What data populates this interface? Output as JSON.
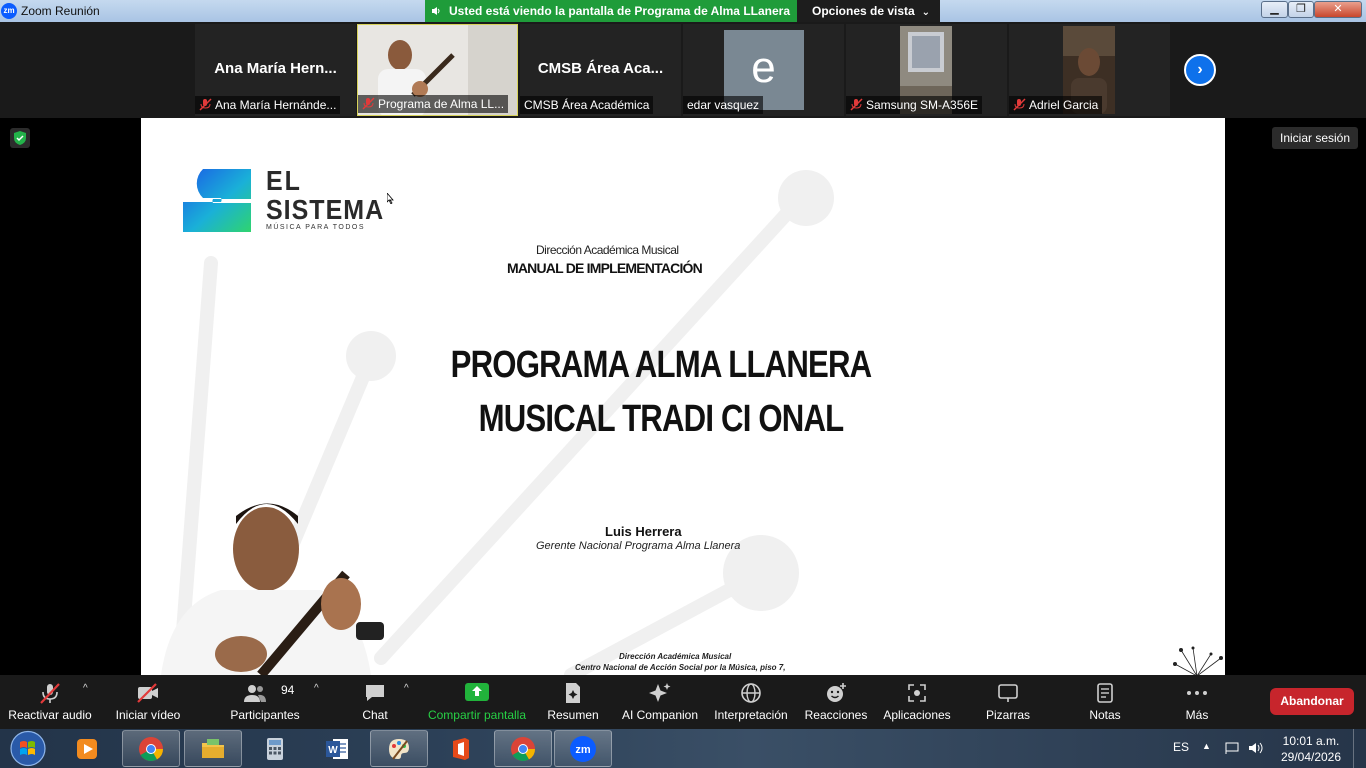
{
  "window": {
    "title": "Zoom Reunión",
    "logo": "zm",
    "share_banner": "Usted está viendo la pantalla de Programa de Alma LLanera",
    "view_options": "Opciones de vista",
    "controls": {
      "minimize": "▁",
      "maximize": "❐",
      "close": "✕"
    }
  },
  "gallery": {
    "tiles": [
      {
        "big_name": "Ana María Hern...",
        "label": "Ana María Hernánde...",
        "muted": true
      },
      {
        "big_name": "",
        "label": "Programa de Alma LL...",
        "muted": true,
        "active": true
      },
      {
        "big_name": "CMSB Área Aca...",
        "label": "CMSB Área Académica",
        "muted": false
      },
      {
        "big_name": "",
        "label": "edar vasquez",
        "muted": false,
        "avatar_letter": "e"
      },
      {
        "big_name": "",
        "label": "Samsung SM-A356E",
        "muted": true
      },
      {
        "big_name": "",
        "label": "Adriel Garcia",
        "muted": true
      }
    ],
    "next_icon": "chevron-right-icon"
  },
  "signin": "Iniciar sesión",
  "slide": {
    "logo_el": "EL",
    "logo_sistema": "SISTEMA",
    "logo_tagline": "MÚSICA PARA TODOS",
    "dir_academica": "Dirección Académica Musical",
    "manual": "MANUAL DE IMPLEMENTACIÓN",
    "title_line1": "PROGRAMA ALMA LLANERA",
    "title_line2": "MUSICAL TRADI CI ONAL",
    "author": "Luis Herrera",
    "author_role": "Gerente Nacional Programa Alma Llanera",
    "footer_line1": "Dirección Académica Musical",
    "footer_line2": "Centro Nacional de Acción Social por la Música, piso 7,"
  },
  "toolbar": {
    "audio": "Reactivar audio",
    "video": "Iniciar vídeo",
    "participants": "Participantes",
    "participants_count": "94",
    "chat": "Chat",
    "share": "Compartir pantalla",
    "summary": "Resumen",
    "ai": "AI Companion",
    "interpretation": "Interpretación",
    "reactions": "Reacciones",
    "apps": "Aplicaciones",
    "whiteboards": "Pizarras",
    "notes": "Notas",
    "more": "Más",
    "leave": "Abandonar",
    "caret": "^"
  },
  "taskbar": {
    "apps": [
      "media-player-icon",
      "chrome-icon",
      "file-explorer-icon",
      "calculator-icon",
      "word-icon",
      "paint-icon",
      "office-icon",
      "chrome-icon",
      "zoom-icon"
    ],
    "zoom_label": "zm",
    "word_label": "W",
    "lang": "ES",
    "up_arrow": "▲",
    "time": "10:01 a.m.",
    "date": "29/04/2026"
  },
  "colors": {
    "accent": "#0e71eb",
    "share_green": "#21b33b",
    "leave_red": "#c7252c",
    "banner_green": "#1f9c3a"
  }
}
